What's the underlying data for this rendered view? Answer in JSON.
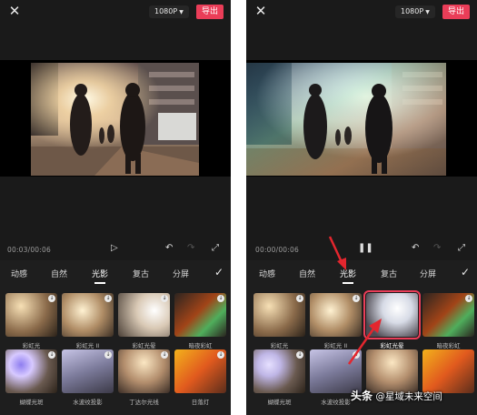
{
  "colors": {
    "accent": "#ea3d58",
    "panel_bg": "#1a1a1a",
    "tray_bg": "#1e1e1e"
  },
  "panels": [
    {
      "resolution": "1080P",
      "export_label": "导出",
      "time": "00:03/00:06",
      "play_state": "paused",
      "tabs": [
        "动感",
        "自然",
        "光影",
        "复古",
        "分屏"
      ],
      "active_tab": "光影",
      "effects": [
        {
          "label": "彩虹光",
          "download": true
        },
        {
          "label": "彩虹光 II",
          "download": true
        },
        {
          "label": "彩虹光晕",
          "download": true
        },
        {
          "label": "暗夜彩虹",
          "download": true
        },
        {
          "label": "蝴蝶光斑",
          "download": true
        },
        {
          "label": "水波纹投影",
          "download": true
        },
        {
          "label": "丁达尔光线",
          "download": true
        },
        {
          "label": "日落灯",
          "download": true
        }
      ]
    },
    {
      "resolution": "1080P",
      "export_label": "导出",
      "time": "00:00/00:06",
      "play_state": "playing",
      "tabs": [
        "动感",
        "自然",
        "光影",
        "复古",
        "分屏"
      ],
      "active_tab": "光影",
      "selected_effect": "彩虹光晕",
      "effects": [
        {
          "label": "彩虹光",
          "download": true
        },
        {
          "label": "彩虹光 II",
          "download": true
        },
        {
          "label": "彩虹光晕",
          "download": false
        },
        {
          "label": "暗夜彩虹",
          "download": true
        },
        {
          "label": "蝴蝶光斑",
          "download": true
        },
        {
          "label": "水波纹投影",
          "download": true
        },
        {
          "label": "",
          "download": false
        },
        {
          "label": "",
          "download": false
        }
      ]
    }
  ],
  "watermark": {
    "brand": "头条",
    "author": "@星域未来空间"
  }
}
